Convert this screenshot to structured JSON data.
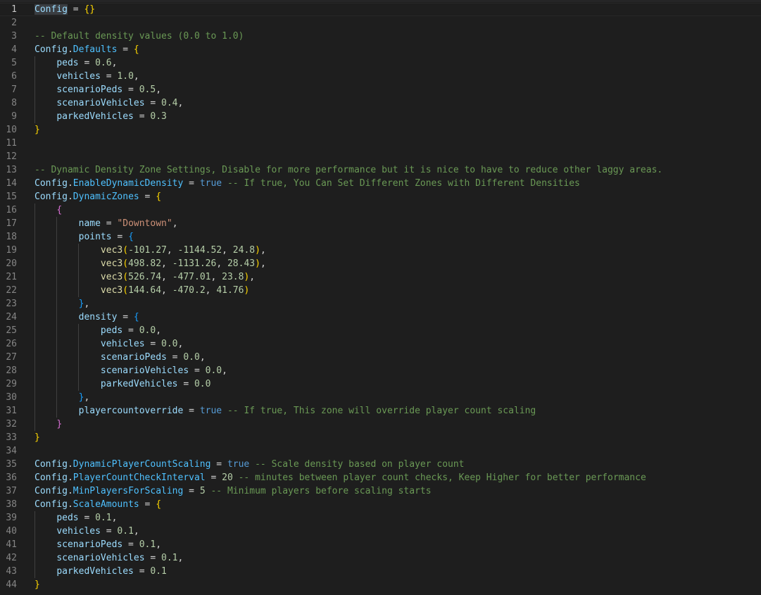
{
  "editor": {
    "language": "lua",
    "current_line": 1,
    "lines": [
      "1",
      "2",
      "3",
      "4",
      "5",
      "6",
      "7",
      "8",
      "9",
      "10",
      "11",
      "12",
      "13",
      "14",
      "15",
      "16",
      "17",
      "18",
      "19",
      "20",
      "21",
      "22",
      "23",
      "24",
      "25",
      "26",
      "27",
      "28",
      "29",
      "30",
      "31",
      "32",
      "33",
      "34",
      "35",
      "36",
      "37",
      "38",
      "39",
      "40",
      "41",
      "42",
      "43",
      "44"
    ],
    "code": [
      "Config = {}",
      "",
      "-- Default density values (0.0 to 1.0)",
      "Config.Defaults = {",
      "    peds = 0.6,",
      "    vehicles = 1.0,",
      "    scenarioPeds = 0.5,",
      "    scenarioVehicles = 0.4,",
      "    parkedVehicles = 0.3",
      "}",
      "",
      "",
      "-- Dynamic Density Zone Settings, Disable for more performance but it is nice to have to reduce other laggy areas.",
      "Config.EnableDynamicDensity = true -- If true, You Can Set Different Zones with Different Densities",
      "Config.DynamicZones = {",
      "    {",
      "        name = \"Downtown\",",
      "        points = {",
      "            vec3(-101.27, -1144.52, 24.8),",
      "            vec3(498.82, -1131.26, 28.43),",
      "            vec3(526.74, -477.01, 23.8),",
      "            vec3(144.64, -470.2, 41.76)",
      "        },",
      "        density = {",
      "            peds = 0.0,",
      "            vehicles = 0.0,",
      "            scenarioPeds = 0.0,",
      "            scenarioVehicles = 0.0,",
      "            parkedVehicles = 0.0",
      "        },",
      "        playercountoverride = true -- If true, This zone will override player count scaling",
      "    }",
      "}",
      "",
      "Config.DynamicPlayerCountScaling = true -- Scale density based on player count",
      "Config.PlayerCountCheckInterval = 20 -- minutes between player count checks, Keep Higher for better performance",
      "Config.MinPlayersForScaling = 5 -- Minimum players before scaling starts",
      "Config.ScaleAmounts = {",
      "    peds = 0.1,",
      "    vehicles = 0.1,",
      "    scenarioPeds = 0.1,",
      "    scenarioVehicles = 0.1,",
      "    parkedVehicles = 0.1",
      "}"
    ]
  },
  "colors": {
    "background": "#1e1e1e",
    "comment": "#6a9955",
    "string": "#ce9178",
    "number": "#b5cea8",
    "keyword_bool": "#569cd6",
    "variable": "#9cdcfe",
    "function": "#dcdcaa",
    "bracket_1": "#ffd700",
    "bracket_2": "#da70d6",
    "bracket_3": "#179fff"
  }
}
